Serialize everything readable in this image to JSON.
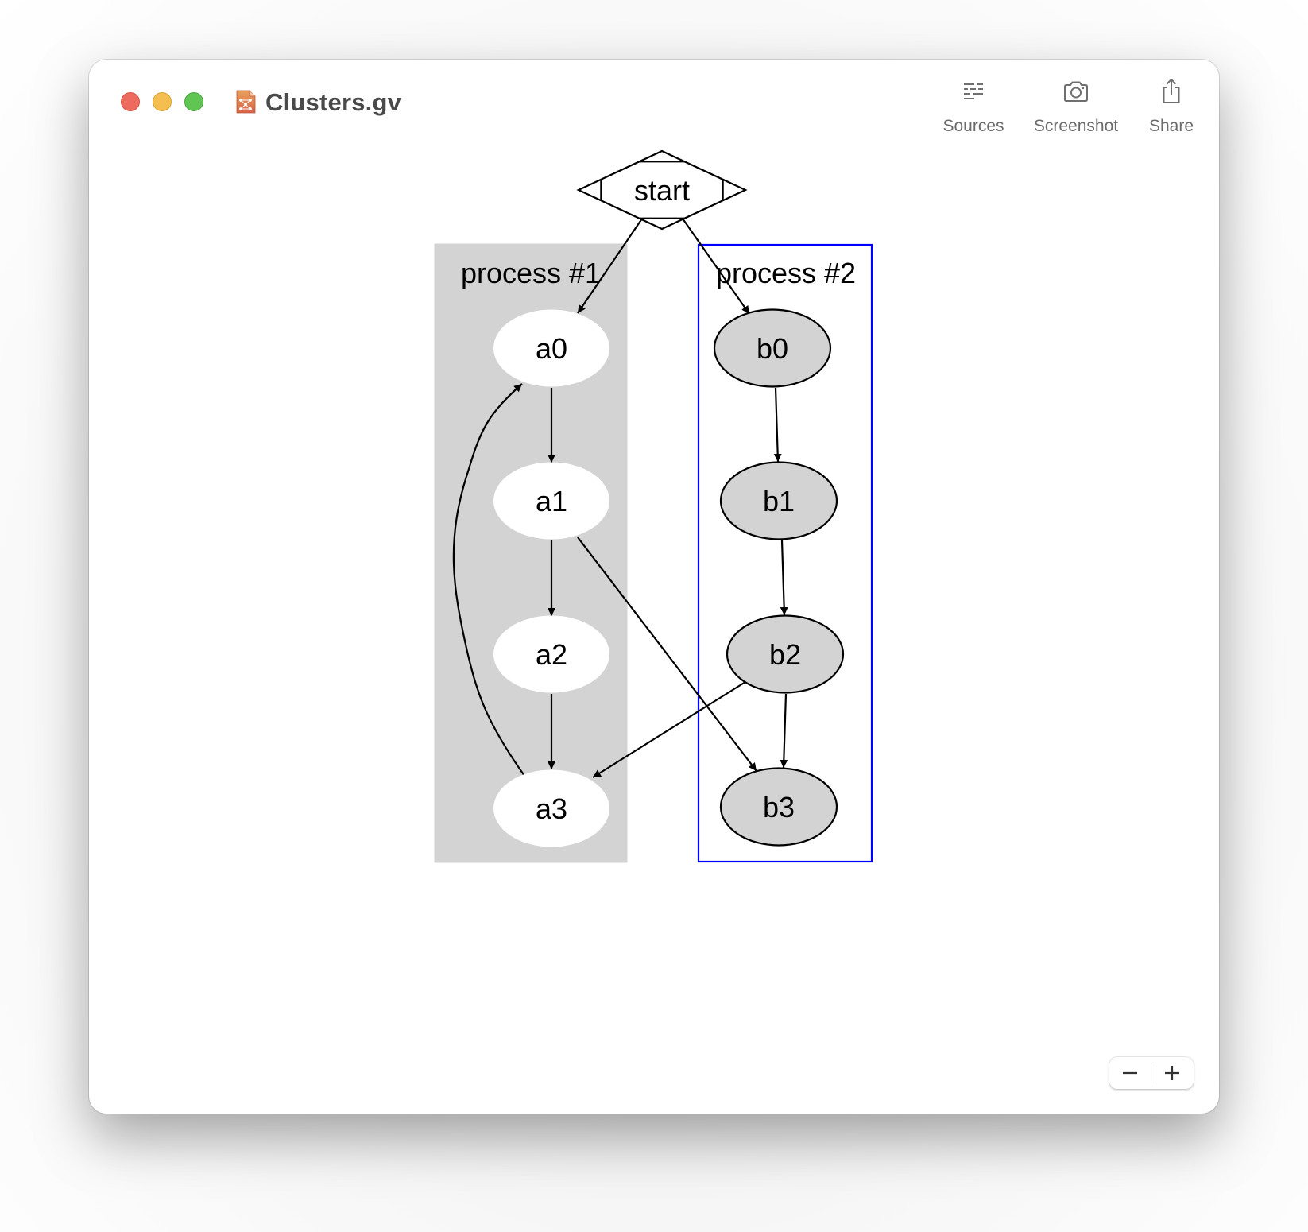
{
  "window": {
    "title": "Clusters.gv",
    "file_icon": "graphviz-document-icon",
    "traffic_lights": [
      "close",
      "minimize",
      "zoom"
    ]
  },
  "toolbar": {
    "items": [
      {
        "label": "Sources",
        "icon": "sources-list-icon"
      },
      {
        "label": "Screenshot",
        "icon": "camera-icon"
      },
      {
        "label": "Share",
        "icon": "share-icon"
      }
    ]
  },
  "graph": {
    "clusters": [
      {
        "id": "cluster_0",
        "label": "process #1",
        "style": "filled",
        "fill": "#d3d3d3",
        "border": "#d3d3d3"
      },
      {
        "id": "cluster_1",
        "label": "process #2",
        "style": "outline",
        "fill": "#ffffff",
        "border": "#0000ff"
      }
    ],
    "nodes": [
      {
        "id": "start",
        "label": "start",
        "shape": "Mdiamond"
      },
      {
        "id": "a0",
        "label": "a0",
        "cluster": "cluster_0",
        "fill": "#ffffff",
        "outline": false
      },
      {
        "id": "a1",
        "label": "a1",
        "cluster": "cluster_0",
        "fill": "#ffffff",
        "outline": false
      },
      {
        "id": "a2",
        "label": "a2",
        "cluster": "cluster_0",
        "fill": "#ffffff",
        "outline": false
      },
      {
        "id": "a3",
        "label": "a3",
        "cluster": "cluster_0",
        "fill": "#ffffff",
        "outline": false
      },
      {
        "id": "b0",
        "label": "b0",
        "cluster": "cluster_1",
        "fill": "#d3d3d3",
        "outline": true
      },
      {
        "id": "b1",
        "label": "b1",
        "cluster": "cluster_1",
        "fill": "#d3d3d3",
        "outline": true
      },
      {
        "id": "b2",
        "label": "b2",
        "cluster": "cluster_1",
        "fill": "#d3d3d3",
        "outline": true
      },
      {
        "id": "b3",
        "label": "b3",
        "cluster": "cluster_1",
        "fill": "#d3d3d3",
        "outline": true
      }
    ],
    "edges": [
      {
        "from": "start",
        "to": "a0"
      },
      {
        "from": "start",
        "to": "b0"
      },
      {
        "from": "a0",
        "to": "a1"
      },
      {
        "from": "a1",
        "to": "a2"
      },
      {
        "from": "a2",
        "to": "a3"
      },
      {
        "from": "a3",
        "to": "a0"
      },
      {
        "from": "a1",
        "to": "b3"
      },
      {
        "from": "b0",
        "to": "b1"
      },
      {
        "from": "b1",
        "to": "b2"
      },
      {
        "from": "b2",
        "to": "b3"
      },
      {
        "from": "b2",
        "to": "a3"
      }
    ]
  },
  "zoom_controls": {
    "zoom_out": "−",
    "zoom_in": "+"
  }
}
